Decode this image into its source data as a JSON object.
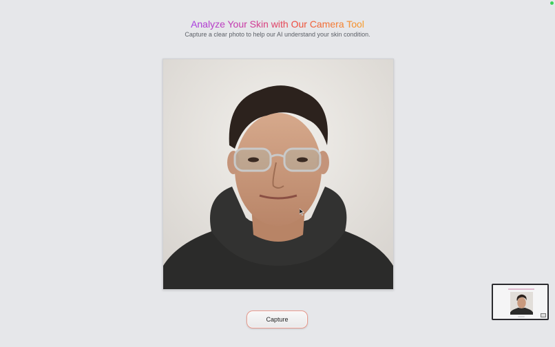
{
  "header": {
    "title": "Analyze Your Skin with Our Camera Tool",
    "subtitle": "Capture a clear photo to help our AI understand your skin condition."
  },
  "camera": {
    "feed_icon": "camera-feed"
  },
  "actions": {
    "capture_label": "Capture"
  },
  "preview_window": {
    "icon": "screen-preview-icon"
  },
  "colors": {
    "background": "#e6e7ea",
    "title_gradient": [
      "#a84cea",
      "#cf4aa6",
      "#ee5a4c",
      "#f5a93b"
    ],
    "capture_border": "#e7998c",
    "status_dot": "#3fd05a"
  }
}
